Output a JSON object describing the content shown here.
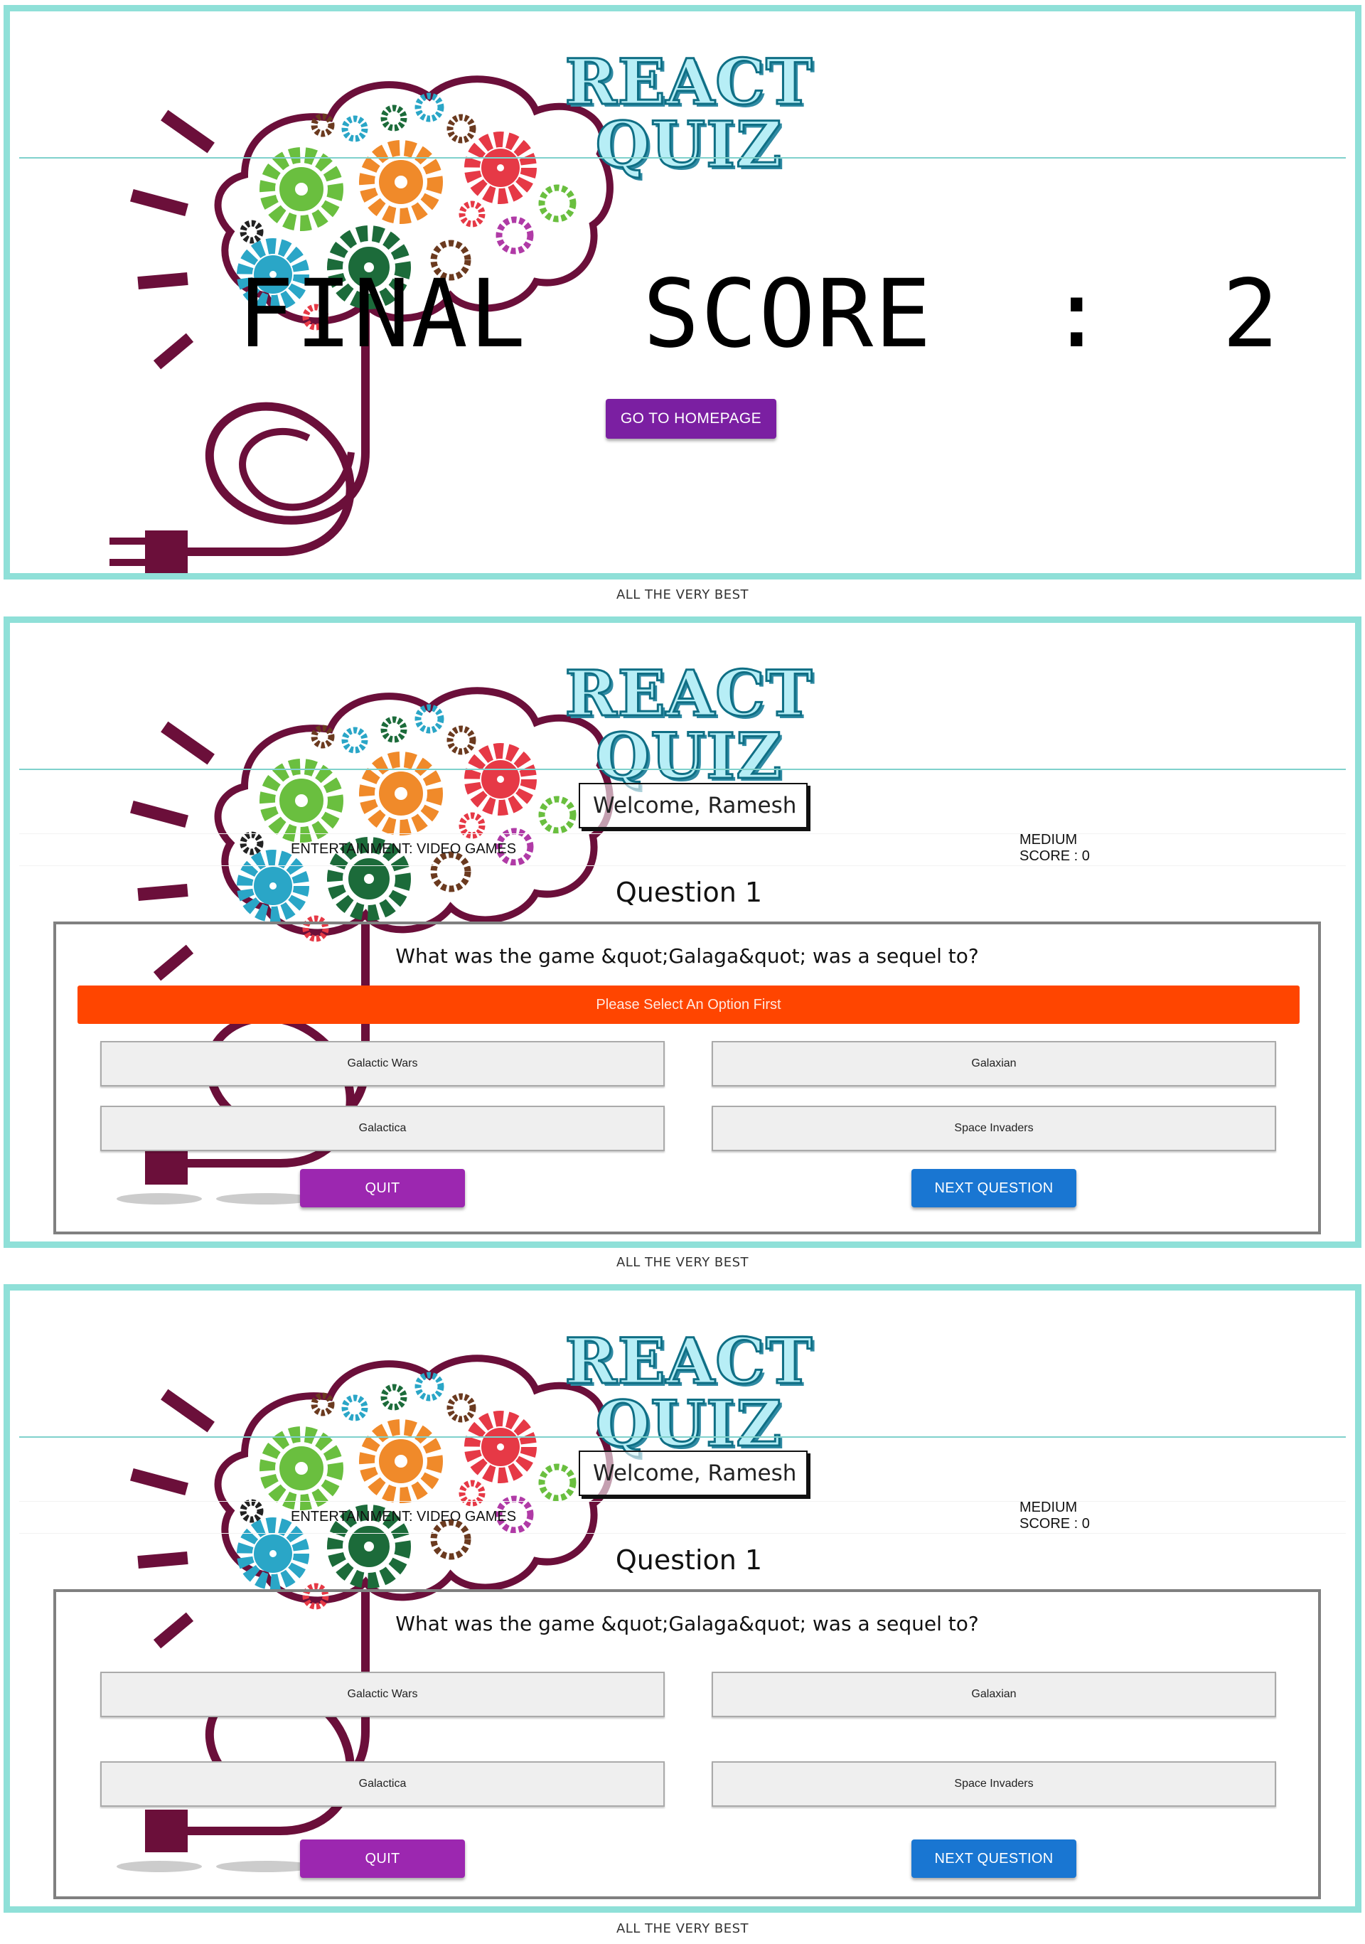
{
  "app": {
    "title": "REACT QUIZ",
    "footer": "ALL THE VERY BEST"
  },
  "result_screen": {
    "final_score_label": "FINAL  SCORE  :  2",
    "home_button": "GO TO HOMEPAGE"
  },
  "quiz_screen_error": {
    "welcome": "Welcome, Ramesh",
    "category": "ENTERTAINMENT: VIDEO GAMES",
    "difficulty": "MEDIUM",
    "score": "SCORE : 0",
    "question_number": "Question 1",
    "question": "What was the game &quot;Galaga&quot; was a sequel to?",
    "error": "Please Select An Option First",
    "options": [
      "Galactic Wars",
      "Galaxian",
      "Galactica",
      "Space Invaders"
    ],
    "quit_button": "QUIT",
    "next_button": "NEXT QUESTION"
  },
  "quiz_screen": {
    "welcome": "Welcome, Ramesh",
    "category": "ENTERTAINMENT: VIDEO GAMES",
    "difficulty": "MEDIUM",
    "score": "SCORE : 0",
    "question_number": "Question 1",
    "question": "What was the game &quot;Galaga&quot; was a sequel to?",
    "options": [
      "Galactic Wars",
      "Galaxian",
      "Galactica",
      "Space Invaders"
    ],
    "quit_button": "QUIT",
    "next_button": "NEXT QUESTION"
  },
  "colors": {
    "panel_border": "#8fe0d8",
    "home_button": "#7b1fa2",
    "quit_button": "#9c27b0",
    "next_button": "#1976d2",
    "error_banner": "#ff4500",
    "brain_outline": "#6b0f3a"
  },
  "icons": {
    "brain": "brain-gears-illustration"
  }
}
